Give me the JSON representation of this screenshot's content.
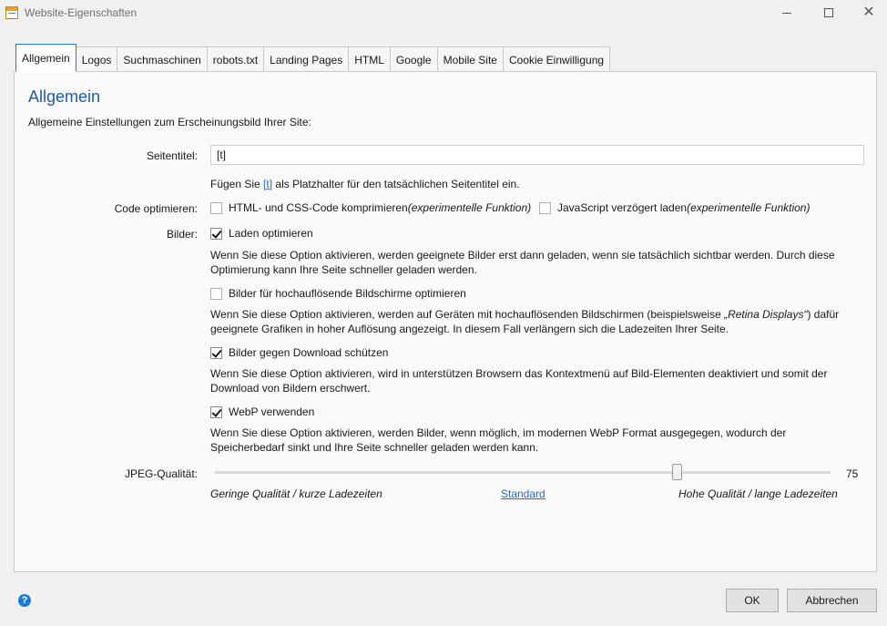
{
  "window": {
    "title": "Website-Eigenschaften"
  },
  "tabs": [
    {
      "label": "Allgemein",
      "active": true
    },
    {
      "label": "Logos"
    },
    {
      "label": "Suchmaschinen"
    },
    {
      "label": "robots.txt"
    },
    {
      "label": "Landing Pages"
    },
    {
      "label": "HTML"
    },
    {
      "label": "Google"
    },
    {
      "label": "Mobile Site"
    },
    {
      "label": "Cookie Einwilligung"
    }
  ],
  "section": {
    "title": "Allgemein",
    "subtitle": "Allgemeine Einstellungen zum Erscheinungsbild Ihrer Site:"
  },
  "page_title_field": {
    "label": "Seitentitel:",
    "value": "[t]",
    "hint_prefix": "Fügen Sie ",
    "hint_link": "[t]",
    "hint_suffix": " als Platzhalter für den tatsächlichen Seitentitel ein."
  },
  "code_optimize": {
    "label": "Code optimieren:",
    "html_css_label": "HTML- und CSS-Code komprimieren ",
    "html_css_note": "(experimentelle Funktion)",
    "html_css_checked": false,
    "js_label": "JavaScript verzögert laden ",
    "js_note": "(experimentelle Funktion)",
    "js_checked": false
  },
  "images": {
    "label": "Bilder:",
    "lazy_label": "Laden optimieren",
    "lazy_checked": true,
    "lazy_desc": "Wenn Sie diese Option aktivieren, werden geeignete Bilder erst dann geladen, wenn sie tatsächlich sichtbar werden. Durch diese Optimierung kann Ihre Seite schneller geladen werden.",
    "retina_label": "Bilder für hochauflösende Bildschirme optimieren",
    "retina_checked": false,
    "retina_desc_prefix": "Wenn Sie diese Option aktivieren, werden auf Geräten mit hochauflösenden Bildschirmen (beispielsweise ",
    "retina_desc_italic": "„Retina Displays“",
    "retina_desc_suffix": ") dafür geeignete Grafiken in hoher Auflösung angezeigt. In diesem Fall verlängern sich die Ladezeiten Ihrer Seite.",
    "protect_label": "Bilder gegen Download schützen",
    "protect_checked": true,
    "protect_desc": "Wenn Sie diese Option aktivieren, wird in unterstützen Browsern das Kontextmenü auf Bild-Elementen deaktiviert und somit der Download von Bildern erschwert.",
    "webp_label": "WebP verwenden",
    "webp_checked": true,
    "webp_desc": "Wenn Sie diese Option aktivieren, werden Bilder, wenn möglich, im modernen WebP Format ausgegegen, wodurch der Speicherbedarf sinkt und Ihre Seite schneller geladen werden kann."
  },
  "jpeg_quality": {
    "label": "JPEG-Qualität:",
    "value": "75",
    "value_fraction": 0.75,
    "low_label": "Geringe Qualität / kurze Ladezeiten",
    "default_link": "Standard",
    "high_label": "Hohe Qualität / lange Ladezeiten"
  },
  "footer": {
    "ok_label": "OK",
    "cancel_label": "Abbrechen"
  },
  "colors": {
    "accent": "#1f7bd1",
    "heading": "#1f5c9a",
    "link": "#1f6fc4"
  }
}
